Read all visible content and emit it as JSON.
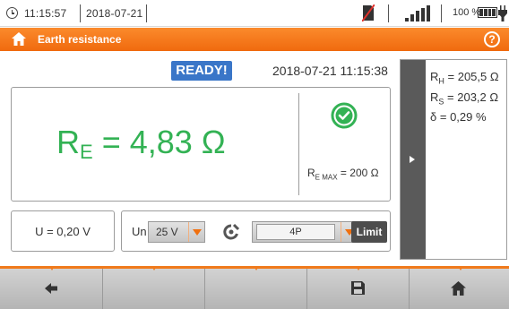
{
  "status_bar": {
    "time": "11:15:57",
    "date": "2018-07-21",
    "battery_percent": "100 %",
    "battery_level": 1.0,
    "signal_level": "full",
    "icons": [
      "clock-icon",
      "sd-card-disabled-icon",
      "signal-icon",
      "battery-icon",
      "plug-icon"
    ]
  },
  "title_bar": {
    "title": "Earth resistance",
    "home_icon": "home-icon",
    "help_icon": "help-icon",
    "help_glyph": "?",
    "color": "#f5781c"
  },
  "measurement": {
    "state": "READY!",
    "timestamp": "2018-07-21 11:15:38",
    "result_symbol": "R",
    "result_subscript": "E",
    "result_value": "= 4,83 Ω",
    "result_color": "#33b254",
    "ok_icon": "check-circle-icon",
    "limit_symbol": "R",
    "limit_subscript": "E MAX",
    "limit_value": "= 200 Ω"
  },
  "voltage": {
    "label": "U = 0,20 V"
  },
  "settings": {
    "un_label": "Un",
    "un_value": "25 V",
    "clamp_icon": "clamp-icon",
    "mode_value": "4P",
    "limit_button": "Limit"
  },
  "side_panel": {
    "rh_symbol": "R",
    "rh_subscript": "H",
    "rh_value": "= 205,5 Ω",
    "rs_symbol": "R",
    "rs_subscript": "S",
    "rs_value": "= 203,2 Ω",
    "delta_symbol": "δ",
    "delta_value": "= 0,29 %",
    "toggle_icon": "triangle-right-icon"
  },
  "bottom_nav": {
    "buttons": [
      "back-arrow-icon",
      "",
      "",
      "save-icon",
      "home-icon"
    ],
    "accent": "#f07a1c"
  }
}
